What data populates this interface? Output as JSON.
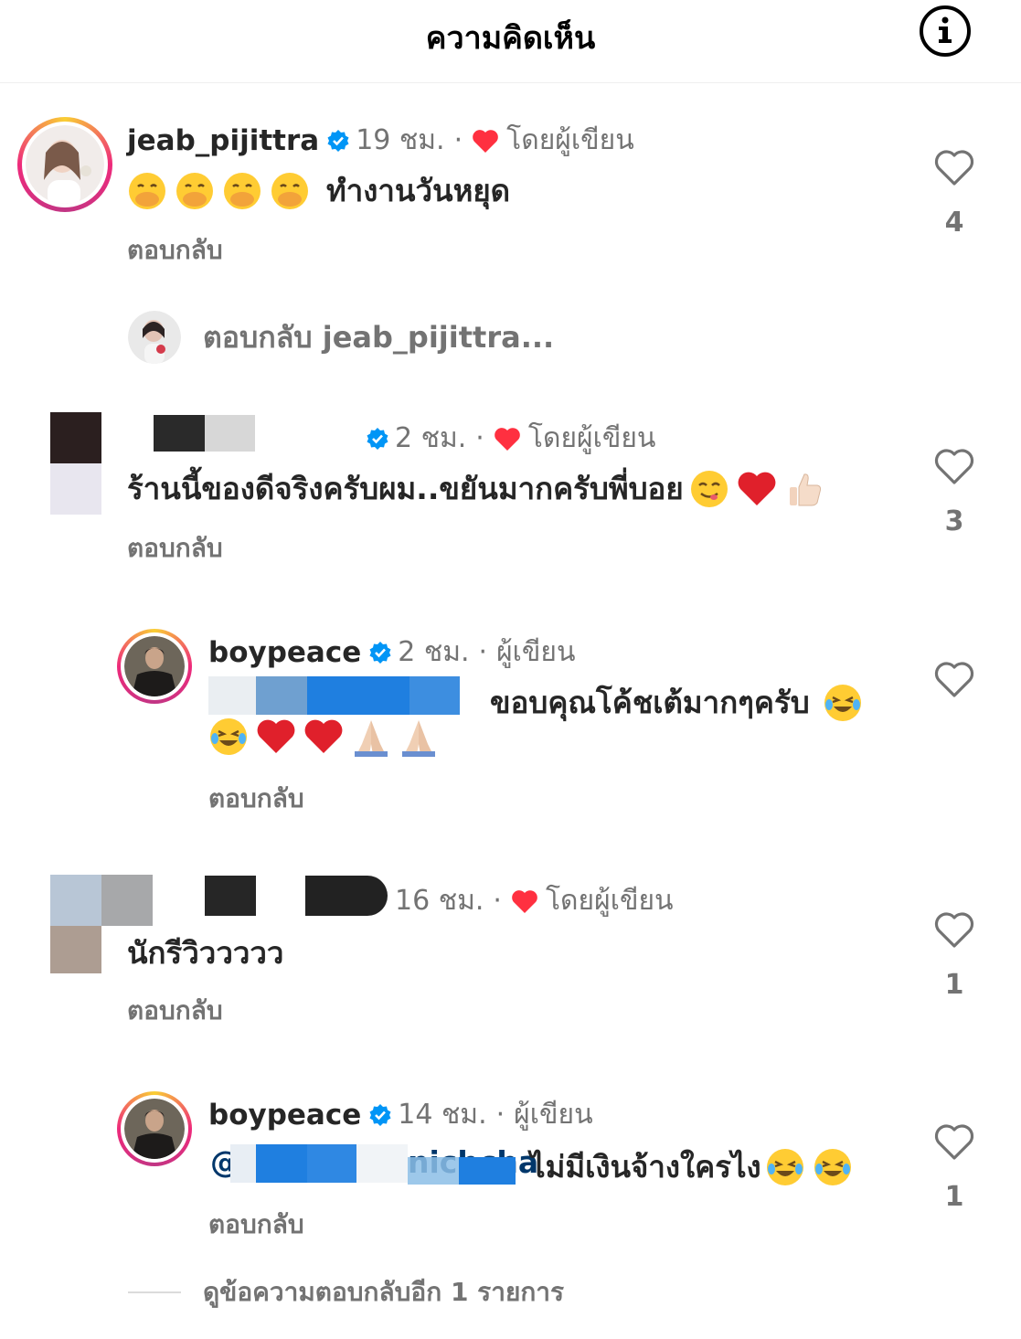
{
  "header": {
    "title": "ความคิดเห็น",
    "info_icon": "info-icon"
  },
  "comments": [
    {
      "username": "jeab_pijittra",
      "time": "19 ชม.",
      "liked_by_author": "โดยผู้เขียน",
      "text": "ทำงานวันหยุด",
      "emojis": [
        "hand-over-mouth",
        "hand-over-mouth",
        "hand-over-mouth",
        "hand-over-mouth"
      ],
      "reply": "ตอบกลับ",
      "likes": "4"
    },
    {
      "username": "",
      "time": "2 ชม.",
      "liked_by_author": "โดยผู้เขียน",
      "text": "ร้านนี้ของดีจริงครับผม..ขยันมากครับพี่บอย",
      "emojis": [
        "yum",
        "red-heart",
        "thumbs-up"
      ],
      "reply": "ตอบกลับ",
      "likes": "3"
    },
    {
      "username": "boypeace",
      "time": "2 ชม.",
      "author_label": "ผู้เขียน",
      "text": "ขอบคุณโค้ชเต้มากๆครับ",
      "emojis": [
        "joy",
        "joy",
        "red-heart",
        "red-heart",
        "folded-hands",
        "folded-hands"
      ],
      "reply": "ตอบกลับ"
    },
    {
      "username": "",
      "time": "16 ชม.",
      "liked_by_author": "โดยผู้เขียน",
      "text": "นักรีวิววววว",
      "reply": "ตอบกลับ",
      "likes": "1"
    },
    {
      "username": "boypeace",
      "time": "14 ชม.",
      "author_label": "ผู้เขียน",
      "mention_prefix": "@",
      "mention_tail": "nichcha",
      "text": "ไม่มีเงินจ้างใครไง",
      "emojis": [
        "joy",
        "joy"
      ],
      "reply": "ตอบกลับ",
      "likes": "1"
    }
  ],
  "reply_prompt": "ตอบกลับ jeab_pijittra...",
  "view_more": "ดูข้อความตอบกลับอีก 1 รายการ",
  "colors": {
    "verified": "#0095f6",
    "heart": "#ff3040",
    "muted": "#737373",
    "text": "#262626"
  }
}
